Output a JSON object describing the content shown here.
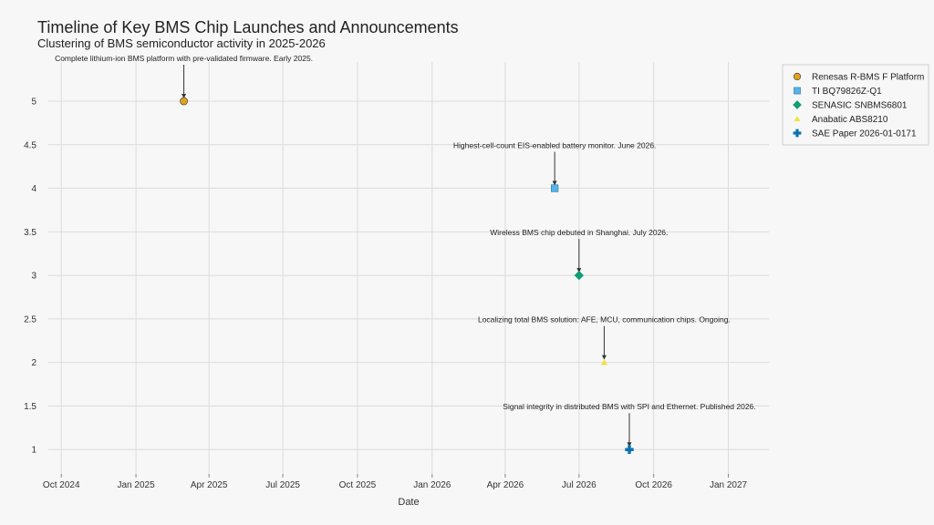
{
  "chart_data": {
    "type": "scatter",
    "title": "Timeline of Key BMS Chip Launches and Announcements",
    "subtitle": "Clustering of BMS semiconductor activity in 2025-2026",
    "xlabel": "Date",
    "ylabel": "",
    "xlim": [
      "2024-09-15",
      "2027-02-20"
    ],
    "ylim": [
      0.72,
      5.45
    ],
    "x_ticks": [
      {
        "date": "2024-10-01",
        "label": "Oct 2024"
      },
      {
        "date": "2025-01-01",
        "label": "Jan 2025"
      },
      {
        "date": "2025-04-01",
        "label": "Apr 2025"
      },
      {
        "date": "2025-07-01",
        "label": "Jul 2025"
      },
      {
        "date": "2025-10-01",
        "label": "Oct 2025"
      },
      {
        "date": "2026-01-01",
        "label": "Jan 2026"
      },
      {
        "date": "2026-04-01",
        "label": "Apr 2026"
      },
      {
        "date": "2026-07-01",
        "label": "Jul 2026"
      },
      {
        "date": "2026-10-01",
        "label": "Oct 2026"
      },
      {
        "date": "2027-01-01",
        "label": "Jan 2027"
      }
    ],
    "y_ticks": [
      1,
      1.5,
      2,
      2.5,
      3,
      3.5,
      4,
      4.5,
      5
    ],
    "y_tick_labels": [
      "1",
      "1.5",
      "2",
      "2.5",
      "3",
      "3.5",
      "4",
      "4.5",
      "5"
    ],
    "grid": true,
    "legend_position": "top-right",
    "series": [
      {
        "name": "Renesas R-BMS F Platform",
        "x": "2025-03-01",
        "y": 5,
        "marker": "circle",
        "color": "#E1A21E",
        "annotation": "Complete lithium-ion BMS platform with pre-validated firmware. Early 2025."
      },
      {
        "name": "TI BQ79826Z-Q1",
        "x": "2026-06-01",
        "y": 4,
        "marker": "square",
        "color": "#56B4E9",
        "annotation": "Highest-cell-count EIS-enabled battery monitor. June 2026."
      },
      {
        "name": "SENASIC SNBMS6801",
        "x": "2026-07-01",
        "y": 3,
        "marker": "diamond",
        "color": "#0E9E73",
        "annotation": "Wireless BMS chip debuted in Shanghai. July 2026."
      },
      {
        "name": "Anabatic ABS8210",
        "x": "2026-08-01",
        "y": 2,
        "marker": "triangle",
        "color": "#F0E442",
        "annotation": "Localizing total BMS solution: AFE, MCU, communication chips. Ongoing."
      },
      {
        "name": "SAE Paper 2026-01-0171",
        "x": "2026-09-01",
        "y": 1,
        "marker": "cross",
        "color": "#0A72B2",
        "annotation": "Signal integrity in distributed BMS with SPI and Ethernet. Published 2026."
      }
    ]
  }
}
